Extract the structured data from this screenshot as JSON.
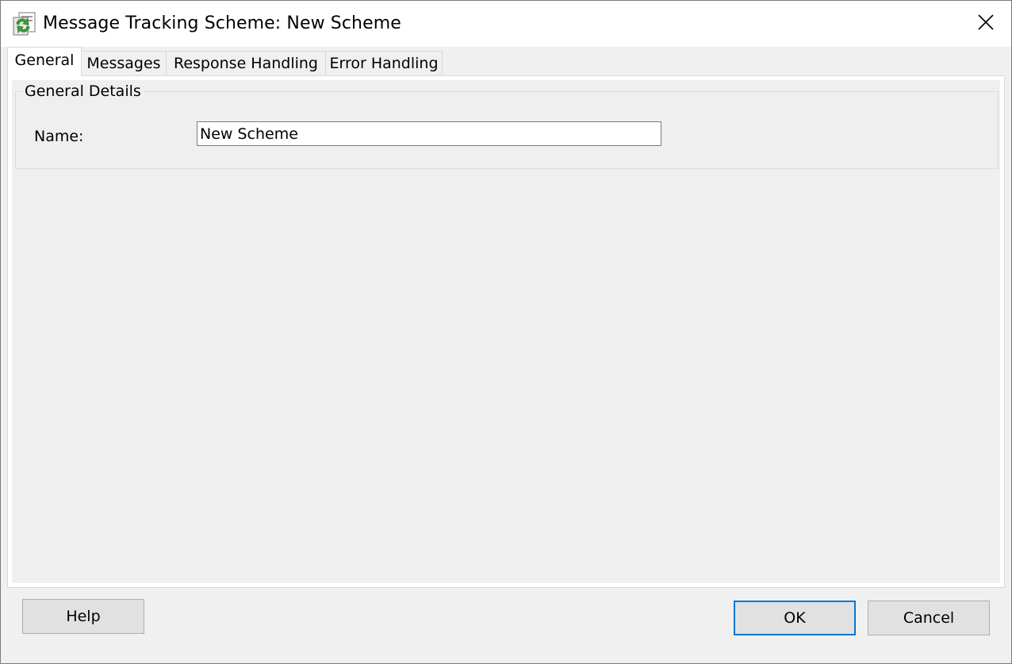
{
  "window": {
    "title": "Message Tracking Scheme: New Scheme",
    "app_icon": "message-tracking-scheme-icon",
    "close_icon": "close-icon"
  },
  "tabs": [
    {
      "label": "General",
      "active": true
    },
    {
      "label": "Messages",
      "active": false
    },
    {
      "label": "Response Handling",
      "active": false
    },
    {
      "label": "Error Handling",
      "active": false
    }
  ],
  "general": {
    "group_title": "General Details",
    "name_label": "Name:",
    "name_value": "New Scheme"
  },
  "buttons": {
    "help": "Help",
    "ok": "OK",
    "cancel": "Cancel"
  },
  "colors": {
    "window_bg": "#f0f0f0",
    "panel_bg": "#efefef",
    "default_button_border": "#0078d7",
    "icon_green": "#3aa639"
  }
}
